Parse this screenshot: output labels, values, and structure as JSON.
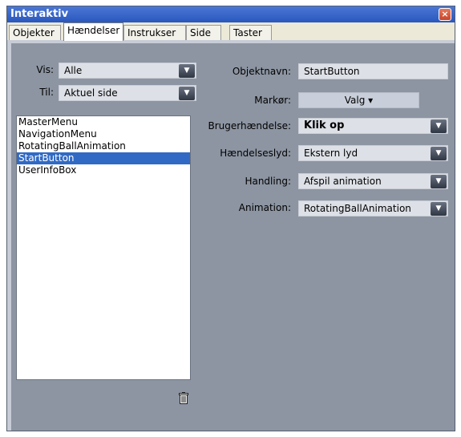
{
  "window": {
    "title": "Interaktiv",
    "close_glyph": "×"
  },
  "tabs": [
    {
      "label": "Objekter",
      "active": false
    },
    {
      "label": "Hændelser",
      "active": true
    },
    {
      "label": "Instrukser",
      "active": false
    },
    {
      "label": "Side",
      "active": false
    },
    {
      "label": "Taster",
      "active": false
    }
  ],
  "left": {
    "vis_label": "Vis:",
    "vis_value": "Alle",
    "til_label": "Til:",
    "til_value": "Aktuel side",
    "objects": [
      "MasterMenu",
      "NavigationMenu",
      "RotatingBallAnimation",
      "StartButton",
      "UserInfoBox"
    ],
    "selected_index": 3,
    "trash_icon": "trash-icon"
  },
  "right": {
    "objektnavn_label": "Objektnavn:",
    "objektnavn_value": "StartButton",
    "markor_label": "Markør:",
    "markor_value": "Valg ▾",
    "brugerhaendelse_label": "Brugerhændelse:",
    "brugerhaendelse_value": "Klik op",
    "haendelseslyd_label": "Hændelseslyd:",
    "haendelseslyd_value": "Ekstern lyd",
    "handling_label": "Handling:",
    "handling_value": "Afspil animation",
    "animation_label": "Animation:",
    "animation_value": "RotatingBallAnimation"
  },
  "colors": {
    "panel_bg": "#8d95a2",
    "title_bar": "#2a57bd",
    "selection": "#316ac5"
  }
}
